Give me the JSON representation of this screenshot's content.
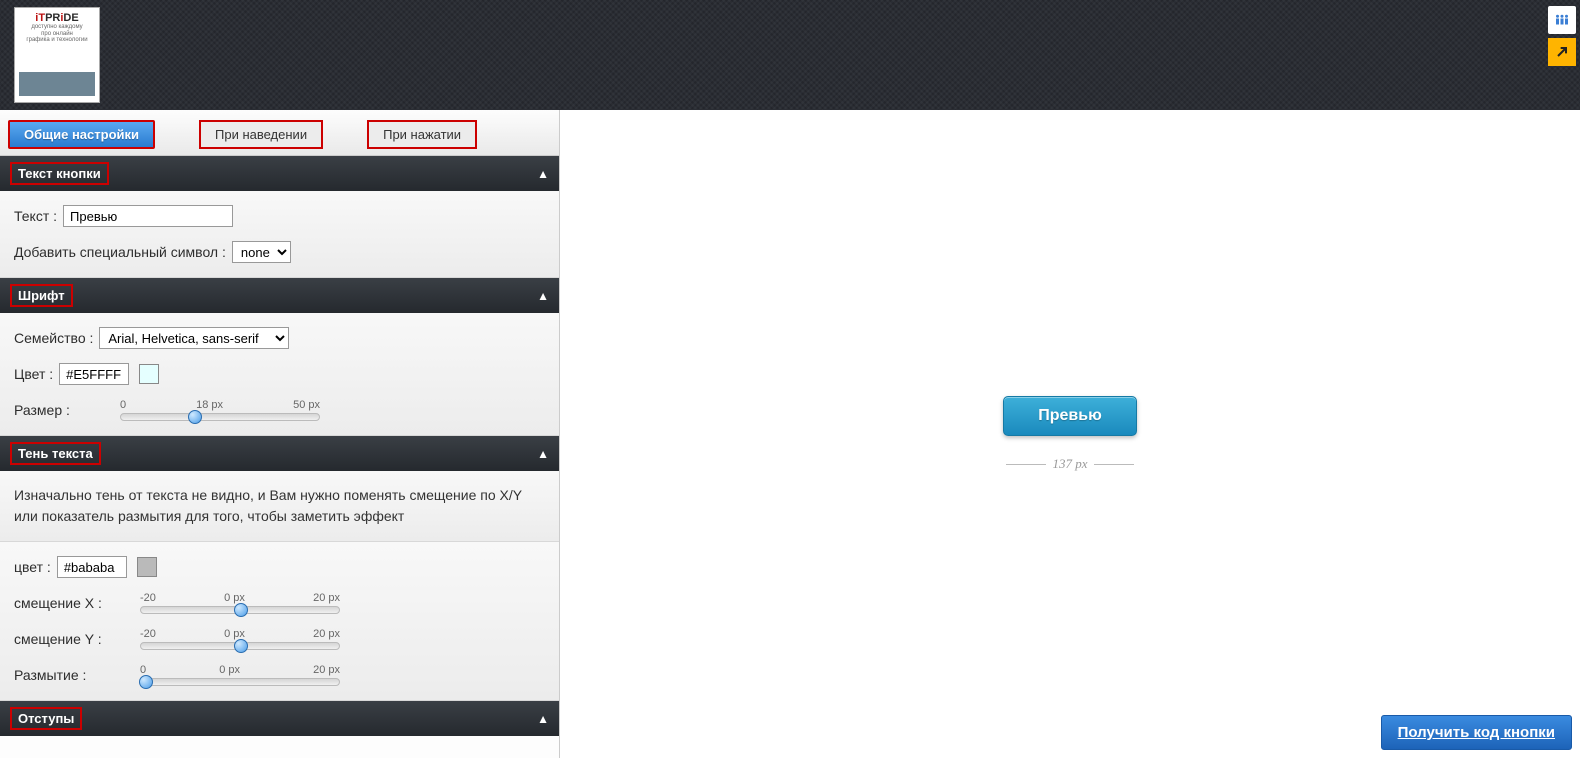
{
  "header": {
    "logo_line1": "iTPRiDE",
    "logo_sub1": "доступно каждому",
    "logo_sub2": "про онлайн",
    "logo_sub3": "графика и технологии"
  },
  "tabs": {
    "general": "Общие настройки",
    "hover": "При наведении",
    "active": "При нажатии"
  },
  "sections": {
    "text": {
      "title": "Текст кнопки",
      "text_label": "Текст :",
      "text_value": "Превью",
      "special_label": "Добавить специальный символ :",
      "special_value": "none"
    },
    "font": {
      "title": "Шрифт",
      "family_label": "Семейство :",
      "family_value": "Arial, Helvetica, sans-serif",
      "color_label": "Цвет :",
      "color_value": "#E5FFFF",
      "size_label": "Размер :",
      "size_min": "0",
      "size_val": "18 px",
      "size_max": "50 px"
    },
    "shadow": {
      "title": "Тень текста",
      "note": "Изначально тень от текста не видно, и Вам нужно поменять смещение по X/Y или показатель размытия для того, чтобы заметить эффект",
      "color_label": "цвет :",
      "color_value": "#bababa",
      "offx_label": "смещение X :",
      "offx_min": "-20",
      "offx_val": "0 px",
      "offx_max": "20 px",
      "offy_label": "смещение Y :",
      "offy_min": "-20",
      "offy_val": "0 px",
      "offy_max": "20 px",
      "blur_label": "Размытие :",
      "blur_min": "0",
      "blur_val": "0 px",
      "blur_max": "20 px"
    },
    "padding": {
      "title": "Отступы"
    }
  },
  "preview": {
    "btn_label": "Превью",
    "width_label": "137 px"
  },
  "footer": {
    "get_code": "Получить код кнопки"
  }
}
